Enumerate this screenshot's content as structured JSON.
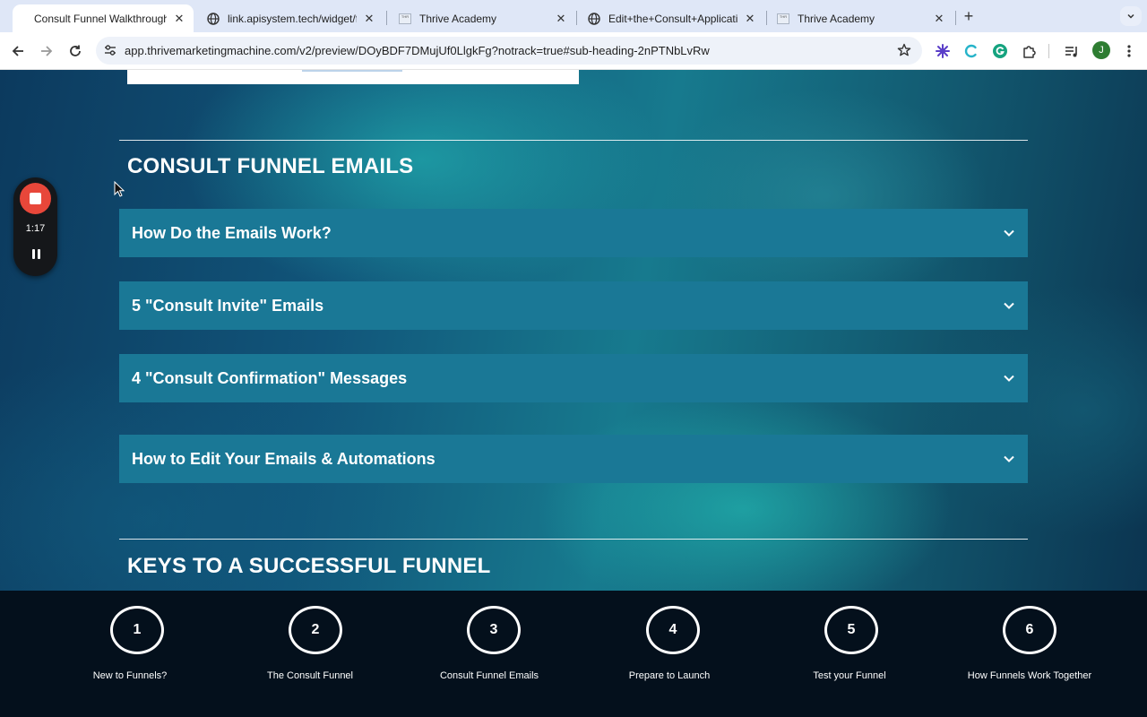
{
  "browser": {
    "tabs": [
      {
        "title": "Consult Funnel Walkthrough",
        "active": true,
        "icon": "none"
      },
      {
        "title": "link.apisystem.tech/widget/fo",
        "active": false,
        "icon": "globe-icon"
      },
      {
        "title": "Thrive Academy",
        "active": false,
        "icon": "thrive-favicon"
      },
      {
        "title": "Edit+the+Consult+Applicatio",
        "active": false,
        "icon": "globe-icon"
      },
      {
        "title": "Thrive Academy",
        "active": false,
        "icon": "thrive-favicon"
      }
    ],
    "url": "app.thrivemarketingmachine.com/v2/preview/DOyBDF7DMujUf0LlgkFg?notrack=true#sub-heading-2nPTNbLvRw",
    "profile_initial": "J"
  },
  "page": {
    "sections": [
      {
        "title": "CONSULT FUNNEL EMAILS",
        "accordions": [
          {
            "label": "How Do the Emails Work?"
          },
          {
            "label": "5 \"Consult Invite\" Emails"
          },
          {
            "label": "4 \"Consult Confirmation\" Messages"
          },
          {
            "label": "How to Edit Your Emails & Automations"
          }
        ]
      },
      {
        "title": "KEYS TO A SUCCESSFUL FUNNEL",
        "accordions": []
      }
    ]
  },
  "steps": [
    {
      "number": "1",
      "label": "New to Funnels?"
    },
    {
      "number": "2",
      "label": "The Consult Funnel"
    },
    {
      "number": "3",
      "label": "Consult Funnel Emails"
    },
    {
      "number": "4",
      "label": "Prepare to Launch"
    },
    {
      "number": "5",
      "label": "Test your Funnel"
    },
    {
      "number": "6",
      "label": "How Funnels Work Together"
    }
  ],
  "recorder": {
    "elapsed": "1:17"
  },
  "colors": {
    "accordion_bg": "#1a7896",
    "stepbar_bg": "#04101c",
    "record_red": "#e8473a"
  }
}
